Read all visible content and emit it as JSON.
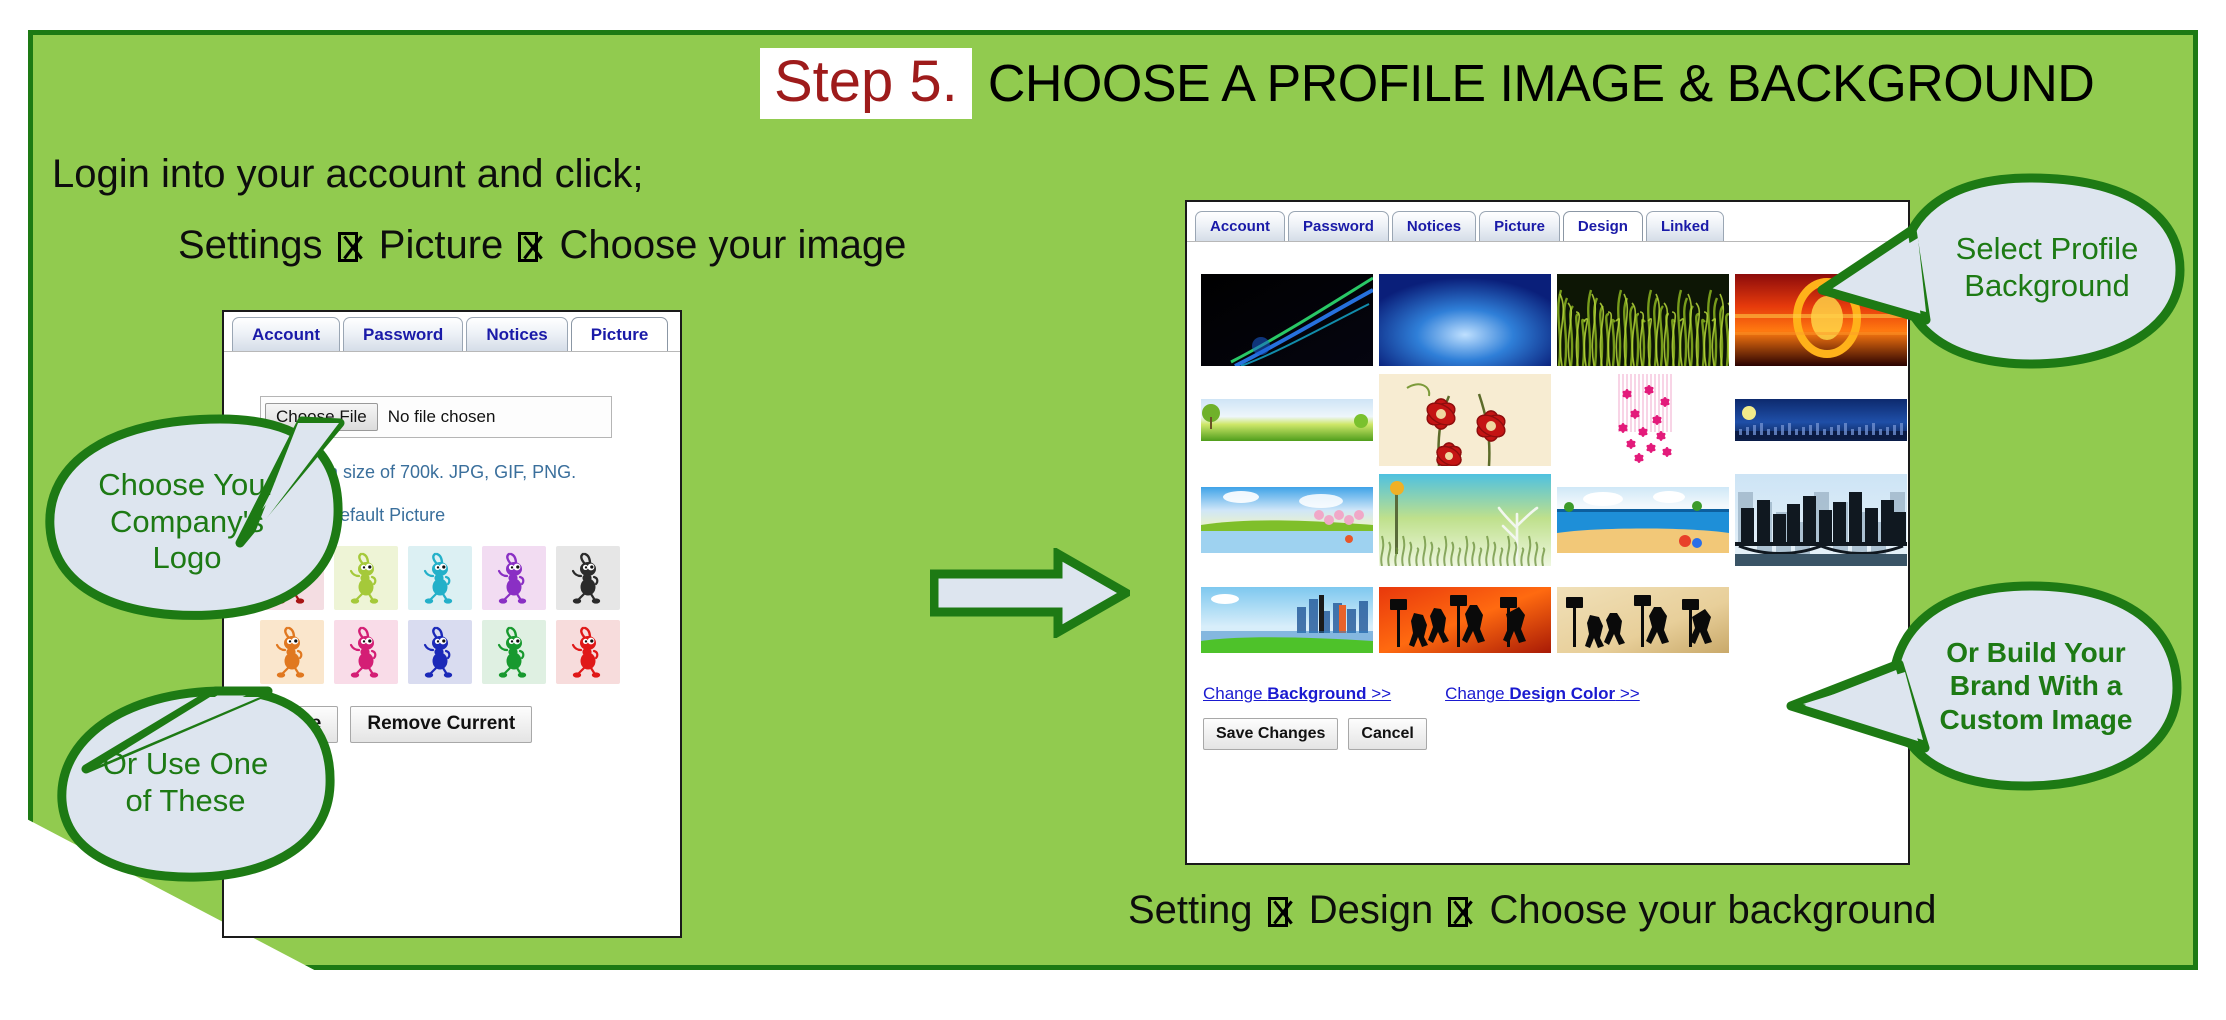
{
  "theme": {
    "panel_green": "#91cb4f",
    "border_green": "#1d7a14",
    "bubble_fill": "#dde5ef",
    "bubble_text": "#1d7a14",
    "step_red": "#9e1b1b",
    "tab_blue": "#1a1aa8",
    "link_blue": "#1a1ad0",
    "hint_blue": "#3a6f9c"
  },
  "header": {
    "step_label": "Step 5.",
    "title": "CHOOSE A PROFILE IMAGE & BACKGROUND"
  },
  "intro": {
    "line1": "Login into your account and click;",
    "path_left": [
      "Settings",
      "Picture",
      "Choose your image"
    ],
    "path_right": [
      "Setting",
      "Design",
      "Choose your background"
    ]
  },
  "left_shot": {
    "tabs": [
      {
        "label": "Account",
        "active": false
      },
      {
        "label": "Password",
        "active": false
      },
      {
        "label": "Notices",
        "active": false
      },
      {
        "label": "Picture",
        "active": true
      }
    ],
    "file_input": {
      "button_label": "Choose File",
      "status_text": "No file chosen"
    },
    "hint_size": "Maximum size of 700k. JPG, GIF, PNG.",
    "hint_default": "Choose Default Picture",
    "default_pictures": [
      {
        "name": "ant-dark-red",
        "ant": "#a81414",
        "bg": "#f4dde2"
      },
      {
        "name": "ant-lime",
        "ant": "#a5c93a",
        "bg": "#eef4d6"
      },
      {
        "name": "ant-cyan",
        "ant": "#23b0c9",
        "bg": "#dcf0f3"
      },
      {
        "name": "ant-purple",
        "ant": "#8a2fc4",
        "bg": "#f2dcf2"
      },
      {
        "name": "ant-black",
        "ant": "#2b2b2b",
        "bg": "#e6e6e6"
      },
      {
        "name": "ant-orange",
        "ant": "#e07820",
        "bg": "#fae6cc"
      },
      {
        "name": "ant-magenta",
        "ant": "#d41e75",
        "bg": "#f9dce8"
      },
      {
        "name": "ant-blue",
        "ant": "#1b29b8",
        "bg": "#d9dcf0"
      },
      {
        "name": "ant-green",
        "ant": "#18992f",
        "bg": "#dff0e2"
      },
      {
        "name": "ant-red",
        "ant": "#e01818",
        "bg": "#f7dcdc"
      }
    ],
    "buttons": {
      "save": "Save",
      "remove": "Remove Current"
    }
  },
  "right_shot": {
    "tabs": [
      {
        "label": "Account",
        "active": false
      },
      {
        "label": "Password",
        "active": false
      },
      {
        "label": "Notices",
        "active": false
      },
      {
        "label": "Picture",
        "active": false
      },
      {
        "label": "Design",
        "active": true
      },
      {
        "label": "Linked",
        "active": false
      }
    ],
    "backgrounds": [
      {
        "name": "neon-streaks-black"
      },
      {
        "name": "blue-radial-glow"
      },
      {
        "name": "green-grass"
      },
      {
        "name": "red-sunset-ring"
      },
      {
        "name": "green-field-banner"
      },
      {
        "name": "red-flowers-cream"
      },
      {
        "name": "pink-falling-blossoms"
      },
      {
        "name": "navy-night-bar"
      },
      {
        "name": "spring-lake-landscape"
      },
      {
        "name": "spring-trees-lamp"
      },
      {
        "name": "beach-summer"
      },
      {
        "name": "city-skyline-bridge"
      },
      {
        "name": "city-waterfront"
      },
      {
        "name": "basketball-red"
      },
      {
        "name": "basketball-tan"
      }
    ],
    "links": [
      {
        "prefix": "Change ",
        "strong": "Background",
        "suffix": " >>"
      },
      {
        "prefix": "Change ",
        "strong": "Design Color",
        "suffix": " >>"
      }
    ],
    "buttons": {
      "save": "Save Changes",
      "cancel": "Cancel"
    }
  },
  "callouts": [
    {
      "name": "choose-company-logo",
      "lines": [
        "Choose Your",
        "Company's",
        "Logo"
      ]
    },
    {
      "name": "or-use-one-of-these",
      "lines": [
        "Or Use One",
        "of These"
      ]
    },
    {
      "name": "select-profile-background",
      "lines": [
        "Select Profile",
        "Background"
      ]
    },
    {
      "name": "build-brand-custom-image",
      "lines": [
        "Or Build Your",
        "Brand With a",
        "Custom Image"
      ]
    }
  ]
}
